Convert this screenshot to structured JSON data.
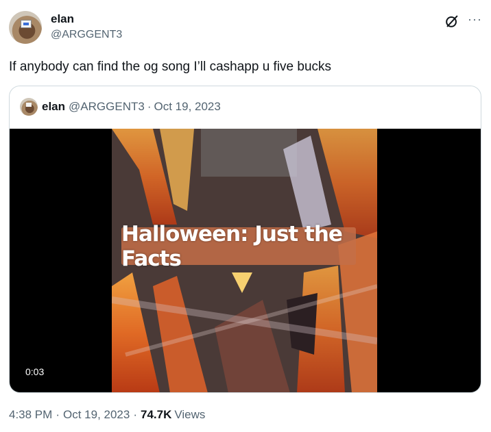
{
  "author": {
    "display_name": "elan",
    "handle": "@ARGGENT3"
  },
  "header_icons": [
    "grok-icon",
    "more-icon"
  ],
  "tweet": {
    "text": "If anybody can find the og song I’ll cashapp u five bucks"
  },
  "quoted_tweet": {
    "display_name": "elan",
    "handle": "@ARGGENT3",
    "separator": "·",
    "date": "Oct 19, 2023",
    "video": {
      "title_overlay": "Halloween: Just the Facts",
      "duration": "0:03"
    }
  },
  "footer": {
    "time": "4:38 PM",
    "separator": "·",
    "date": "Oct 19, 2023",
    "views_count": "74.7K",
    "views_label": "Views"
  },
  "more_glyph": "···"
}
